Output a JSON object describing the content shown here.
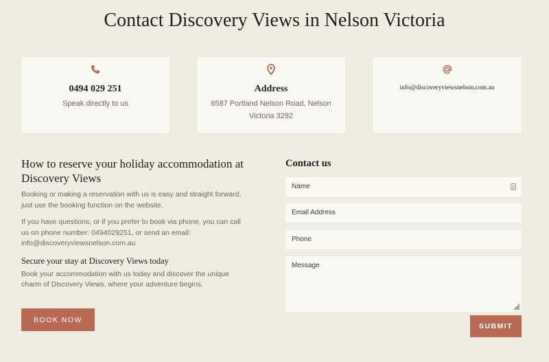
{
  "page": {
    "title": "Contact Discovery Views in Nelson Victoria"
  },
  "cards": {
    "phone": {
      "icon": "phone-icon",
      "title": "0494 029 251",
      "subtitle": "Speak directly to us"
    },
    "address": {
      "icon": "location-pin-icon",
      "title": "Address",
      "line1": "6587 Portland Nelson Road, Nelson",
      "line2": "Victoria 3292"
    },
    "email": {
      "icon": "at-icon",
      "text": "info@discoveryviewsnelson.com.au"
    }
  },
  "reserve": {
    "heading_line1": "How to reserve your holiday accommodation at",
    "heading_line2": "Discovery Views",
    "para1_line1": "Booking or making a reservation with us is easy and straight forward,",
    "para1_line2": "just use the booking function on the website.",
    "para2_line1": "If you have questions, or if you prefer to book via phone, you can call",
    "para2_line2": "us on phone number: 0494029251, or send an email:",
    "para2_line3": "info@discoveryviewsnelson.com.au",
    "subheading": "Secure your stay at Discovery Views today",
    "para3_line1": "Book your accommodation with us today and discover the unique",
    "para3_line2": "charm of Discovery Views, where your adventure begins.",
    "book_button": "BOOK NOW"
  },
  "form": {
    "title": "Contact us",
    "name_placeholder": "Name",
    "email_placeholder": "Email Address",
    "phone_placeholder": "Phone",
    "message_placeholder": "Message",
    "submit_label": "SUBMIT"
  },
  "colors": {
    "background": "#f0ece2",
    "card": "#f9f8f3",
    "accent": "#b86a55",
    "heading": "#1d1d1d"
  }
}
